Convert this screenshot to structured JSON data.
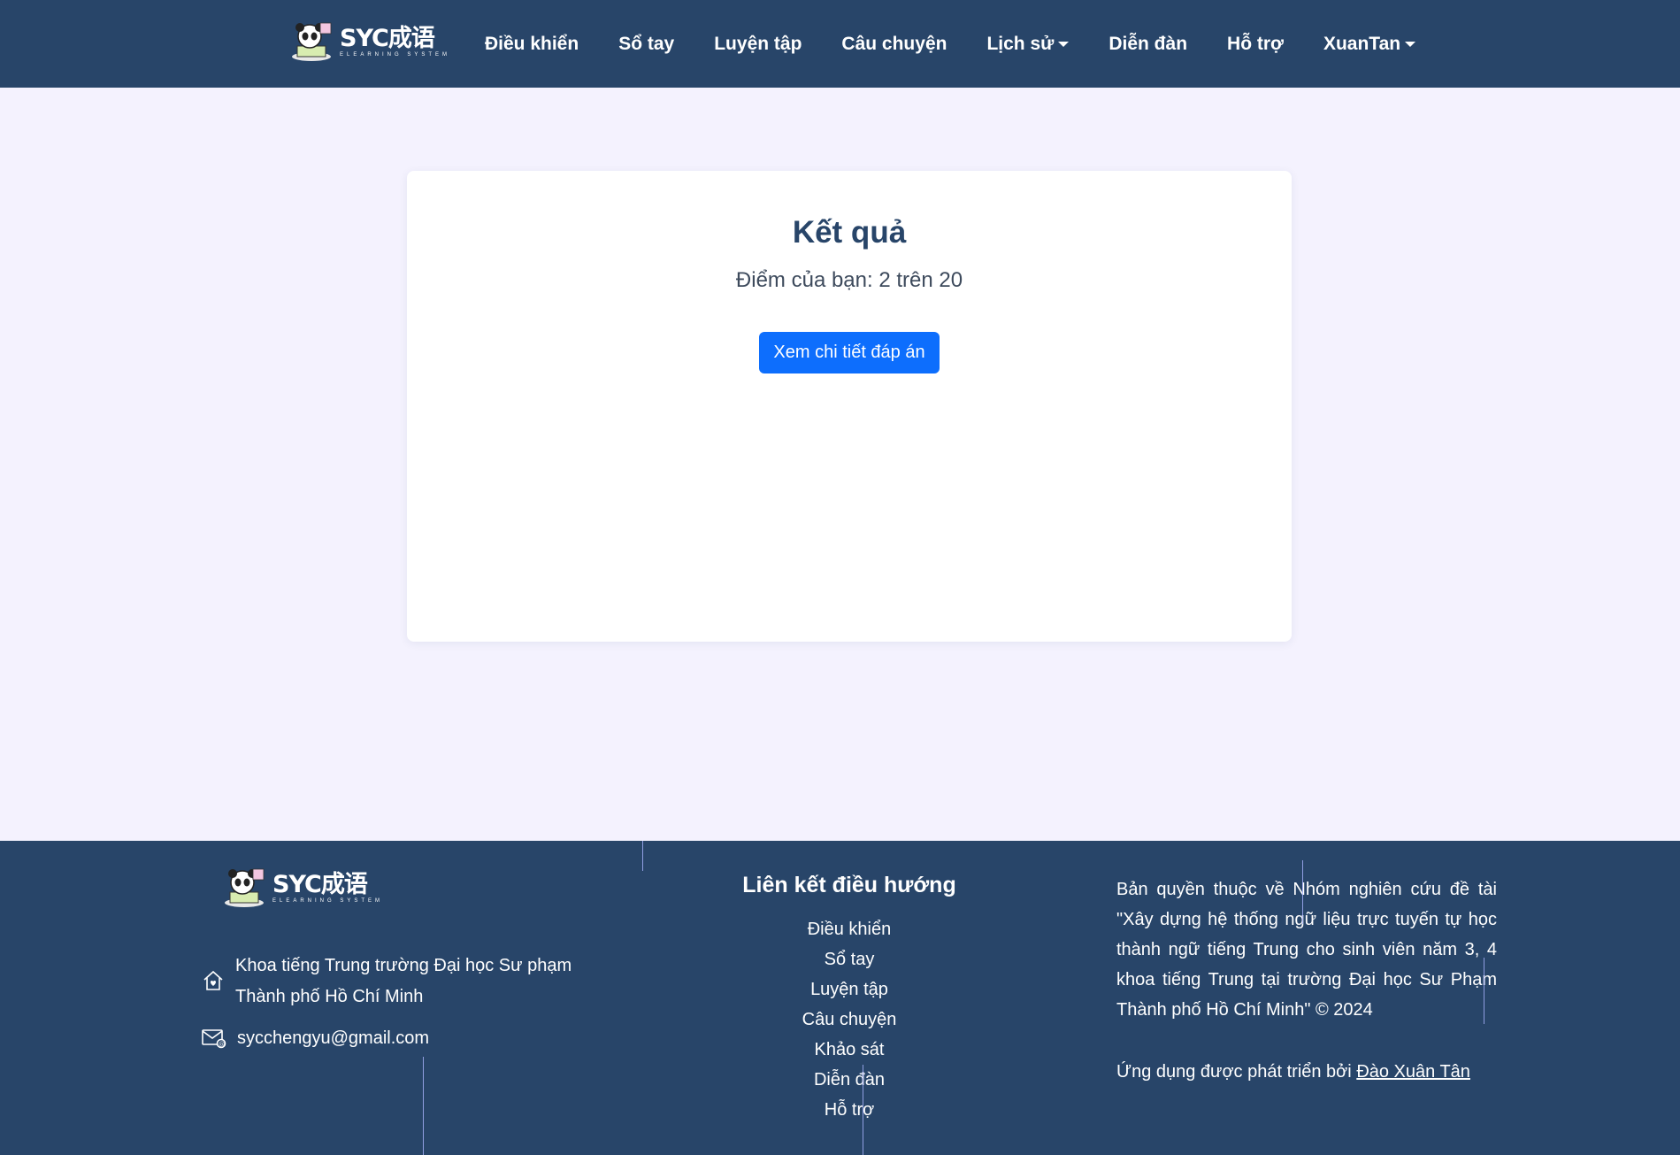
{
  "colors": {
    "nav_bg": "#284569",
    "page_bg": "#f4f2fe",
    "primary": "#0d6efd"
  },
  "brand": {
    "name": "SYC成语",
    "tagline": "ELEARNING SYSTEM"
  },
  "nav": {
    "items": [
      {
        "label": "Điều khiển"
      },
      {
        "label": "Sổ tay"
      },
      {
        "label": "Luyện tập"
      },
      {
        "label": "Câu chuyện"
      },
      {
        "label": "Lịch sử",
        "dropdown": true
      },
      {
        "label": "Diễn đàn"
      },
      {
        "label": "Hỗ trợ"
      },
      {
        "label": "XuanTan",
        "dropdown": true
      }
    ]
  },
  "result": {
    "title": "Kết quả",
    "score": "Điểm của bạn: 2 trên 20",
    "details_button": "Xem chi tiết đáp án"
  },
  "footer": {
    "address": "Khoa tiếng Trung trường Đại học Sư phạm Thành phố Hồ Chí Minh",
    "email": "sycchengyu@gmail.com",
    "links_title": "Liên kết điều hướng",
    "links": [
      "Điều khiển",
      "Sổ tay",
      "Luyện tập",
      "Câu chuyện",
      "Khảo sát",
      "Diễn đàn",
      "Hỗ trợ"
    ],
    "copyright": "Bản quyền thuộc về Nhóm nghiên cứu đề tài \"Xây dựng hệ thống ngữ liệu trực tuyến tự học thành ngữ tiếng Trung cho sinh viên năm 3, 4 khoa tiếng Trung tại trường Đại học Sư Phạm Thành phố Hồ Chí Minh\" © 2024",
    "developed_by": "Ứng dụng được phát triển bởi",
    "developer": "Đào Xuân Tân"
  }
}
